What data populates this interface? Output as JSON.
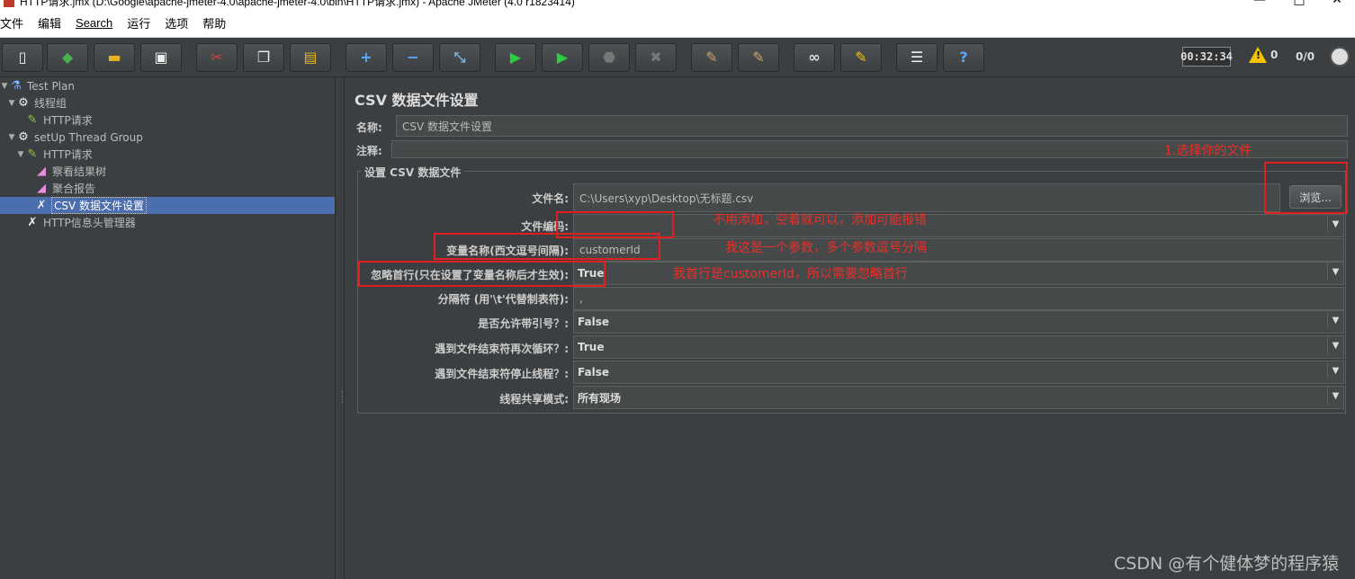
{
  "window": {
    "title": "HTTP请求.jmx (D:\\Google\\apache-jmeter-4.0\\apache-jmeter-4.0\\bin\\HTTP请求.jmx) - Apache JMeter (4.0 r1823414)"
  },
  "menu": [
    "文件",
    "编辑",
    "Search",
    "运行",
    "选项",
    "帮助"
  ],
  "toolbar": {
    "timer": "00:32:34",
    "warning_count": "0",
    "thread_count": "0/0"
  },
  "tree": {
    "items": [
      {
        "label": "Test Plan",
        "icon": "flask-icon"
      },
      {
        "label": "线程组",
        "icon": "gear-icon"
      },
      {
        "label": "HTTP请求",
        "icon": "pipette-icon"
      },
      {
        "label": "setUp Thread Group",
        "icon": "gear-icon"
      },
      {
        "label": "HTTP请求",
        "icon": "pipette-icon"
      },
      {
        "label": "察看结果树",
        "icon": "chart-icon"
      },
      {
        "label": "聚合报告",
        "icon": "chart-icon"
      },
      {
        "label": "CSV 数据文件设置",
        "icon": "tools-icon"
      },
      {
        "label": "HTTP信息头管理器",
        "icon": "tools-icon"
      }
    ]
  },
  "panel": {
    "title": "CSV 数据文件设置",
    "name_label": "名称:",
    "name_value": "CSV 数据文件设置",
    "comment_label": "注释:",
    "comment_value": "",
    "group_title": "设置 CSV 数据文件",
    "filename_label": "文件名:",
    "filename_value": "C:\\Users\\xyp\\Desktop\\无标题.csv",
    "browse_label": "浏览...",
    "encoding_label": "文件编码:",
    "encoding_value": "",
    "varnames_label": "变量名称(西文逗号间隔):",
    "varnames_value": "customerId",
    "ignore_first_label": "忽略首行(只在设置了变量名称后才生效):",
    "ignore_first_value": "True",
    "delimiter_label": "分隔符 (用'\\t'代替制表符):",
    "delimiter_value": ",",
    "allow_quoted_label": "是否允许带引号？:",
    "allow_quoted_value": "False",
    "recycle_label": "遇到文件结束符再次循环？:",
    "recycle_value": "True",
    "stop_thread_label": "遇到文件结束符停止线程？:",
    "stop_thread_value": "False",
    "sharing_label": "线程共享模式:",
    "sharing_value": "所有现场"
  },
  "annotations": {
    "note1": "1.选择你的文件",
    "note2": "不用添加，空着就可以，添加可能报错",
    "note3": "我这是一个参数，多个参数逗号分隔",
    "note4": "我首行是customerId，所以需要忽略首行",
    "color": "#e02020"
  },
  "watermark": "CSDN @有个健体梦的程序猿"
}
